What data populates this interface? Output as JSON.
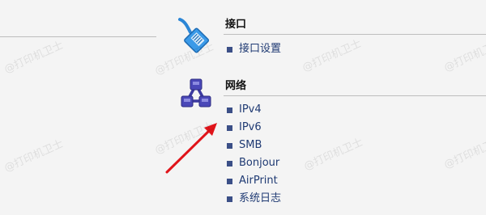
{
  "sections": {
    "interface": {
      "title": "接口",
      "icon": "ethernet-cable-icon",
      "items": [
        {
          "label": "接口设置"
        }
      ]
    },
    "network": {
      "title": "网络",
      "icon": "network-topology-icon",
      "items": [
        {
          "label": "IPv4"
        },
        {
          "label": "IPv6"
        },
        {
          "label": "SMB"
        },
        {
          "label": "Bonjour"
        },
        {
          "label": "AirPrint"
        },
        {
          "label": "系统日志"
        }
      ]
    }
  },
  "watermark": {
    "text": "@打印机卫士"
  },
  "colors": {
    "background": "#f4f4f4",
    "link": "#1f3a73",
    "bullet": "#3b4f87",
    "divider": "#bdbdbd",
    "cable_icon": "#2b86d6",
    "network_icon": "#3c3aa0",
    "annotation_arrow": "#e0141a"
  },
  "annotation": {
    "icon": "red-arrow-icon"
  }
}
